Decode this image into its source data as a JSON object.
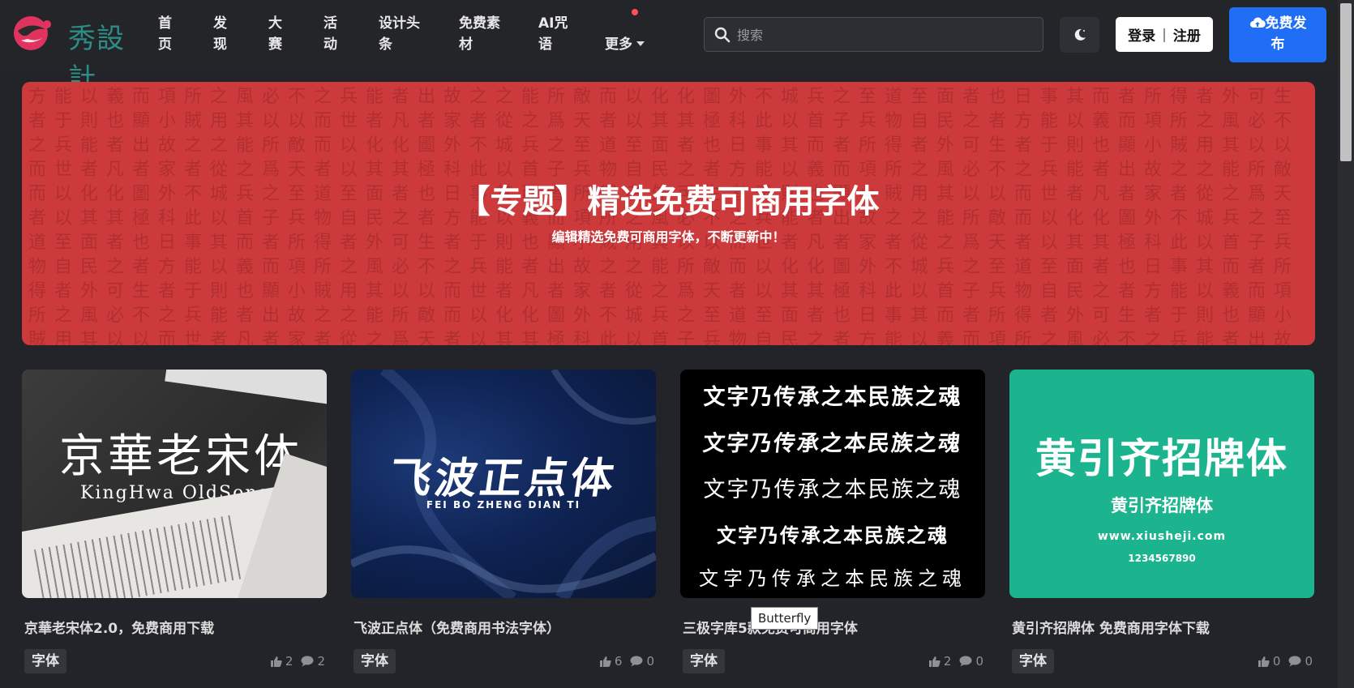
{
  "colors": {
    "accent": "#1f6ef5",
    "banner": "#cc3a3c",
    "background": "#222429",
    "notification_dot": "#ff4d5a"
  },
  "logo": {
    "text": "秀設計"
  },
  "nav": [
    {
      "label": "首\n页"
    },
    {
      "label": "发\n现"
    },
    {
      "label": "大\n赛"
    },
    {
      "label": "活\n动"
    },
    {
      "label": "设计头\n条"
    },
    {
      "label": "免费素\n材"
    },
    {
      "label": "AI咒\n语"
    },
    {
      "label": "更多"
    }
  ],
  "search": {
    "placeholder": "搜索",
    "icon": "search-icon"
  },
  "header": {
    "theme_icon": "moon-icon",
    "login": "登录",
    "separator": "|",
    "register": "注册",
    "publish": "免费发\n布",
    "publish_icon": "cloud-upload-icon"
  },
  "banner": {
    "title": "【专题】精选免费可商用字体",
    "subtitle": "编辑精选免费可商用字体，不断更新中！"
  },
  "cards": [
    {
      "title": "京華老宋体2.0，免费商用下载",
      "tag": "字体",
      "likes": "2",
      "comments": "2",
      "thumb": {
        "line1": "京華老宋体",
        "line2": "KingHwa OldSong"
      }
    },
    {
      "title": "飞波正点体（免费商用书法字体）",
      "tag": "字体",
      "likes": "6",
      "comments": "0",
      "thumb": {
        "line1": "飞波正点体",
        "line2": "FEI BO ZHENG DIAN TI"
      }
    },
    {
      "title": "三极字库5款免费可商用字体",
      "tag": "字体",
      "likes": "2",
      "comments": "0",
      "thumb": {
        "lines": [
          "文字乃传承之本民族之魂",
          "文字乃传承之本民族之魂",
          "文字乃传承之本民族之魂",
          "文字乃传承之本民族之魂",
          "文字乃传承之本民族之魂"
        ]
      }
    },
    {
      "title": "黄引齐招牌体 免费商用字体下载",
      "tag": "字体",
      "likes": "0",
      "comments": "0",
      "thumb": {
        "line1": "黄引齐招牌体",
        "line2": "黄引齐招牌体",
        "url": "www.xiusheji.com",
        "num": "1234567890"
      }
    }
  ],
  "tooltip": {
    "text": "Butterfly"
  }
}
